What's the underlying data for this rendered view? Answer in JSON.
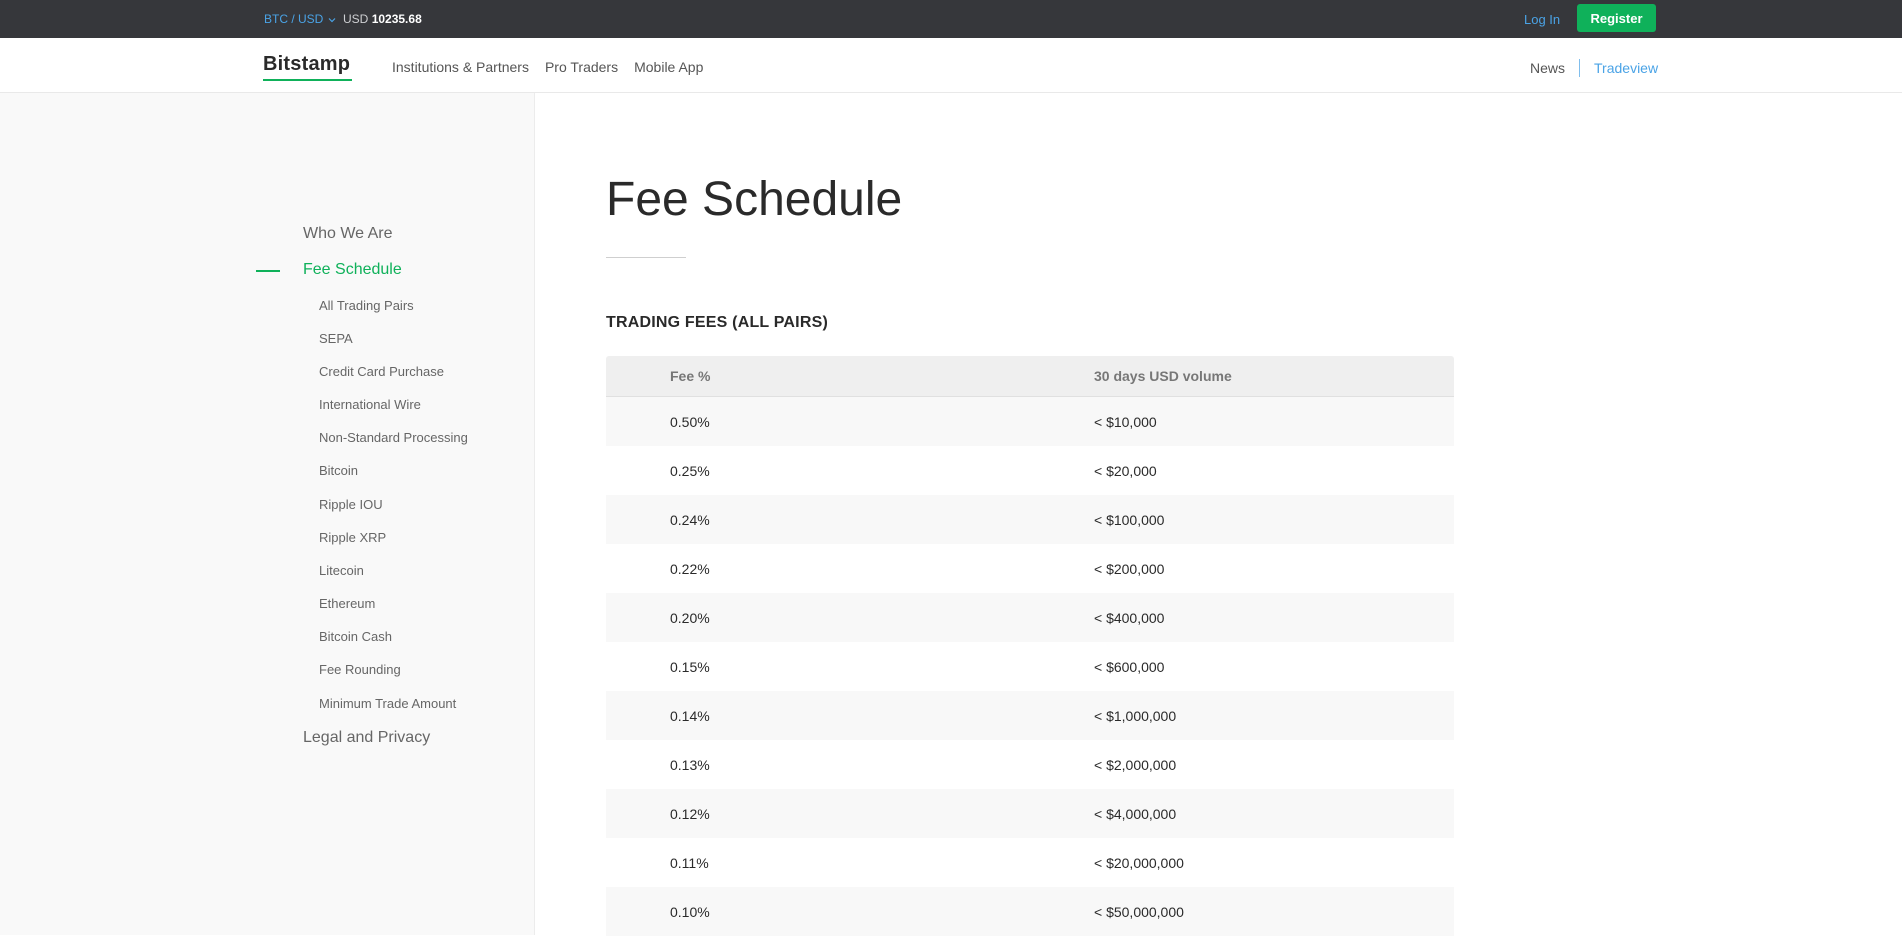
{
  "topbar": {
    "pair": "BTC / USD",
    "price_currency": "USD",
    "price_value": "10235.68",
    "login": "Log In",
    "register": "Register"
  },
  "nav": {
    "logo": "Bitstamp",
    "links": [
      "Institutions & Partners",
      "Pro Traders",
      "Mobile App"
    ],
    "news": "News",
    "tradeview": "Tradeview"
  },
  "sidebar": {
    "who_we_are": "Who We Are",
    "fee_schedule": "Fee Schedule",
    "sub_items": [
      "All Trading Pairs",
      "SEPA",
      "Credit Card Purchase",
      "International Wire",
      "Non-Standard Processing",
      "Bitcoin",
      "Ripple IOU",
      "Ripple XRP",
      "Litecoin",
      "Ethereum",
      "Bitcoin Cash",
      "Fee Rounding",
      "Minimum Trade Amount"
    ],
    "legal": "Legal and Privacy"
  },
  "colors": {
    "accent_green": "#0fb15a",
    "link_blue": "#4aa3e6",
    "topbar_bg": "#36373b"
  },
  "main": {
    "title": "Fee Schedule",
    "section": "TRADING FEES (ALL PAIRS)",
    "table": {
      "headers": [
        "Fee %",
        "30 days USD volume"
      ],
      "rows": [
        [
          "0.50%",
          "< $10,000"
        ],
        [
          "0.25%",
          "< $20,000"
        ],
        [
          "0.24%",
          "< $100,000"
        ],
        [
          "0.22%",
          "< $200,000"
        ],
        [
          "0.20%",
          "< $400,000"
        ],
        [
          "0.15%",
          "< $600,000"
        ],
        [
          "0.14%",
          "< $1,000,000"
        ],
        [
          "0.13%",
          "< $2,000,000"
        ],
        [
          "0.12%",
          "< $4,000,000"
        ],
        [
          "0.11%",
          "< $20,000,000"
        ],
        [
          "0.10%",
          "< $50,000,000"
        ]
      ]
    }
  }
}
